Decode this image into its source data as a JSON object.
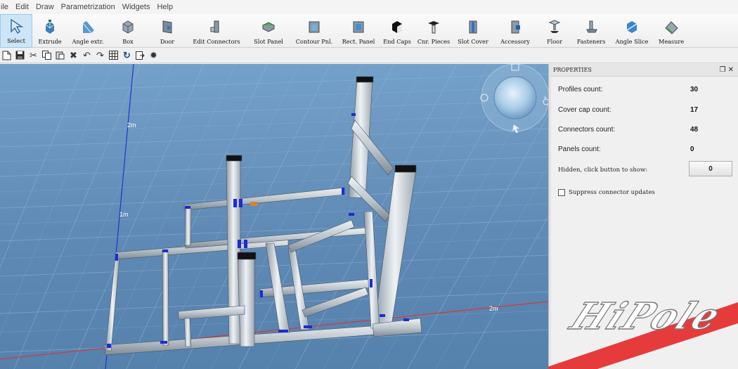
{
  "menu": [
    "ile",
    "Edit",
    "Draw",
    "Parametrization",
    "Widgets",
    "Help"
  ],
  "ribbon": [
    {
      "label": "Select",
      "icon": "select-arrow-icon",
      "active": true
    },
    {
      "label": "Extrude",
      "icon": "extrude-icon"
    },
    {
      "label": "Angle extr.",
      "icon": "angle-extrude-icon"
    },
    {
      "label": "Box",
      "icon": "box-icon"
    },
    {
      "label": "Door",
      "icon": "door-icon"
    },
    {
      "label": "Edit Connectors",
      "icon": "edit-connectors-icon"
    },
    {
      "label": "Slot Panel",
      "icon": "slot-panel-icon"
    },
    {
      "label": "Contour Pnl.",
      "icon": "contour-panel-icon"
    },
    {
      "label": "Rect. Panel",
      "icon": "rect-panel-icon"
    },
    {
      "label": "End Caps",
      "icon": "end-caps-icon"
    },
    {
      "label": "Cnr. Pieces",
      "icon": "corner-pieces-icon"
    },
    {
      "label": "Slot Cover",
      "icon": "slot-cover-icon"
    },
    {
      "label": "Accessory",
      "icon": "accessory-icon"
    },
    {
      "label": "Floor",
      "icon": "floor-icon"
    },
    {
      "label": "Fasteners",
      "icon": "fasteners-icon"
    },
    {
      "label": "Angle Slice",
      "icon": "angle-slice-icon"
    },
    {
      "label": "Measure",
      "icon": "measure-icon"
    }
  ],
  "toolbar_icons": [
    "new-file-icon",
    "save-icon",
    "cut-icon",
    "copy-icon",
    "paste-icon",
    "delete-icon",
    "undo-icon",
    "redo-icon",
    "grid-icon",
    "refresh-icon",
    "export-icon",
    "bug-icon"
  ],
  "viewport": {
    "axis_labels": {
      "top": "2m",
      "left": "1m",
      "right": "2m"
    }
  },
  "properties": {
    "title": "PROPERTIES",
    "rows": [
      {
        "label": "Profiles count:",
        "value": "30"
      },
      {
        "label": "Cover cap count:",
        "value": "17"
      },
      {
        "label": "Connectors count:",
        "value": "48"
      },
      {
        "label": "Panels count:",
        "value": "0"
      }
    ],
    "hidden_label": "Hidden, click button to show:",
    "hidden_value": "0",
    "suppress_label": "Suppress connector updates",
    "suppress_checked": false
  },
  "logo": "HiPole"
}
